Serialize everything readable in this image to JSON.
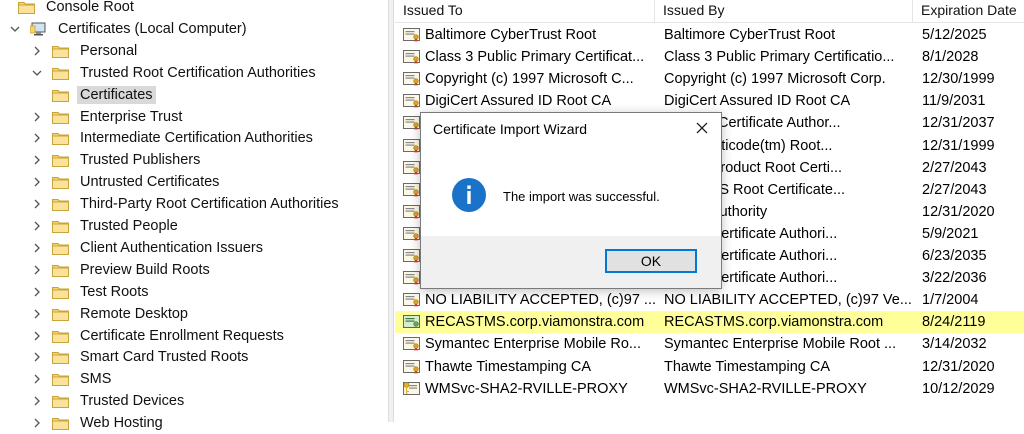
{
  "tree": {
    "items": [
      {
        "label": "Console Root",
        "chevron": "none"
      },
      {
        "label": "Certificates (Local Computer)",
        "chevron": "down"
      },
      {
        "label": "Personal",
        "chevron": "right"
      },
      {
        "label": "Trusted Root Certification Authorities",
        "chevron": "down"
      },
      {
        "label": "Certificates",
        "chevron": "none"
      },
      {
        "label": "Enterprise Trust",
        "chevron": "right"
      },
      {
        "label": "Intermediate Certification Authorities",
        "chevron": "right"
      },
      {
        "label": "Trusted Publishers",
        "chevron": "right"
      },
      {
        "label": "Untrusted Certificates",
        "chevron": "right"
      },
      {
        "label": "Third-Party Root Certification Authorities",
        "chevron": "right"
      },
      {
        "label": "Trusted People",
        "chevron": "right"
      },
      {
        "label": "Client Authentication Issuers",
        "chevron": "right"
      },
      {
        "label": "Preview Build Roots",
        "chevron": "right"
      },
      {
        "label": "Test Roots",
        "chevron": "right"
      },
      {
        "label": "Remote Desktop",
        "chevron": "right"
      },
      {
        "label": "Certificate Enrollment Requests",
        "chevron": "right"
      },
      {
        "label": "Smart Card Trusted Roots",
        "chevron": "right"
      },
      {
        "label": "SMS",
        "chevron": "right"
      },
      {
        "label": "Trusted Devices",
        "chevron": "right"
      },
      {
        "label": "Web Hosting",
        "chevron": "right"
      }
    ]
  },
  "list": {
    "columns": [
      "Issued To",
      "Issued By",
      "Expiration Date"
    ],
    "rows": [
      {
        "issued_to": "Baltimore CyberTrust Root",
        "issued_by": "Baltimore CyberTrust Root",
        "expiration": "5/12/2025"
      },
      {
        "issued_to": "Class 3 Public Primary Certificat...",
        "issued_by": "Class 3 Public Primary Certificatio...",
        "expiration": "8/1/2028"
      },
      {
        "issued_to": "Copyright (c) 1997 Microsoft C...",
        "issued_by": "Copyright (c) 1997 Microsoft Corp.",
        "expiration": "12/30/1999"
      },
      {
        "issued_to": "DigiCert Assured ID Root CA",
        "issued_by": "DigiCert Assured ID Root CA",
        "expiration": "11/9/2031"
      },
      {
        "issued_to": "",
        "issued_by": "dy Root Certificate Author...",
        "expiration": "12/31/2037"
      },
      {
        "issued_to": "",
        "issued_by": "ft Authenticode(tm) Root...",
        "expiration": "12/31/1999"
      },
      {
        "issued_to": "",
        "issued_by": "ft ECC Product Root Certi...",
        "expiration": "2/27/2043"
      },
      {
        "issued_to": "",
        "issued_by": "ft ECC TS Root Certificate...",
        "expiration": "2/27/2043"
      },
      {
        "issued_to": "",
        "issued_by": "ft Root Authority",
        "expiration": "12/31/2020"
      },
      {
        "issued_to": "",
        "issued_by": "ft Root Certificate Authori...",
        "expiration": "5/9/2021"
      },
      {
        "issued_to": "",
        "issued_by": "ft Root Certificate Authori...",
        "expiration": "6/23/2035"
      },
      {
        "issued_to": "",
        "issued_by": "ft Root Certificate Authori...",
        "expiration": "3/22/2036"
      },
      {
        "issued_to": "NO LIABILITY ACCEPTED, (c)97 ...",
        "issued_by": "NO LIABILITY ACCEPTED, (c)97 Ve...",
        "expiration": "1/7/2004"
      },
      {
        "issued_to": "RECASTMS.corp.viamonstra.com",
        "issued_by": "RECASTMS.corp.viamonstra.com",
        "expiration": "8/24/2119",
        "highlight": true
      },
      {
        "issued_to": "Symantec Enterprise Mobile Ro...",
        "issued_by": "Symantec Enterprise Mobile Root ...",
        "expiration": "3/14/2032"
      },
      {
        "issued_to": "Thawte Timestamping CA",
        "issued_by": "Thawte Timestamping CA",
        "expiration": "12/31/2020"
      },
      {
        "issued_to": "WMSvc-SHA2-RVILLE-PROXY",
        "issued_by": "WMSvc-SHA2-RVILLE-PROXY",
        "expiration": "10/12/2029",
        "key": true
      }
    ]
  },
  "dialog": {
    "title": "Certificate Import Wizard",
    "message": "The import was successful.",
    "ok_label": "OK"
  },
  "colors": {
    "highlight": "#ffff99",
    "info_blue": "#1a73c9",
    "focus_border": "#0078d7",
    "folder_yellow": "#f6d36b"
  }
}
